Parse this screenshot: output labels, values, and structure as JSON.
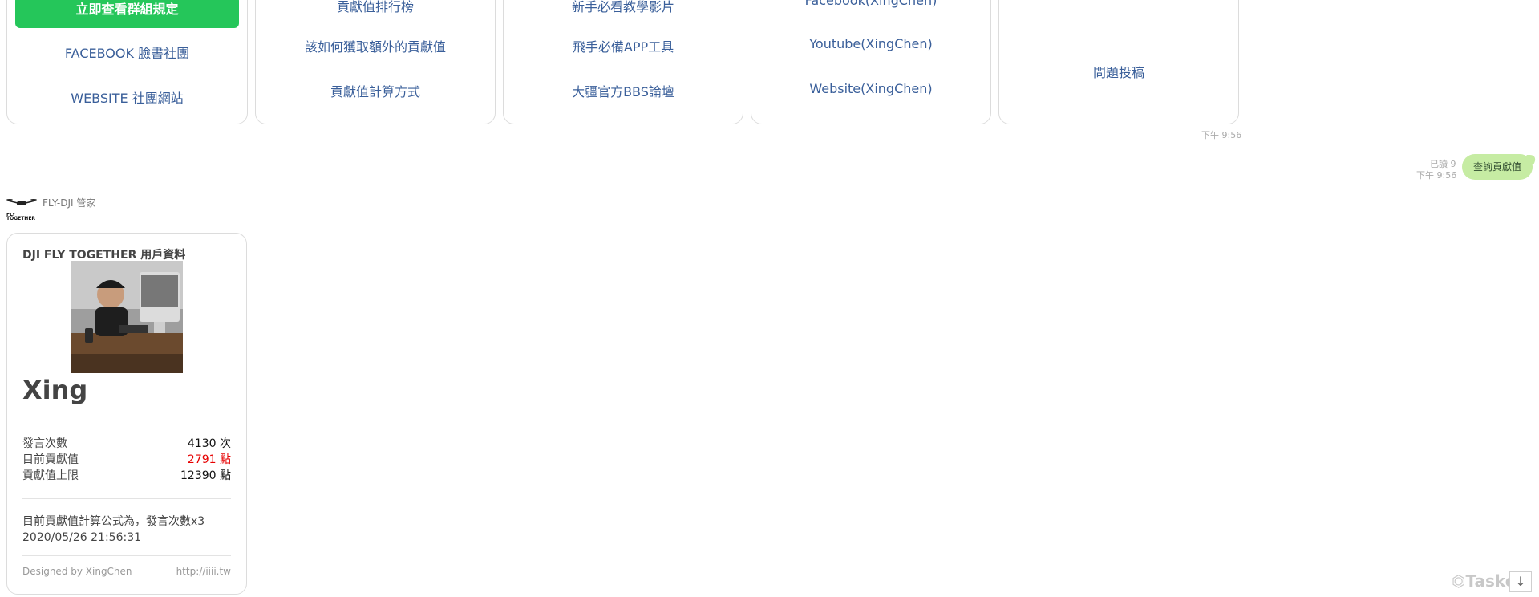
{
  "cards": [
    {
      "button_label": "立即查看群組規定",
      "links": [
        "FACEBOOK 臉書社團",
        "WEBSITE 社團網站"
      ]
    },
    {
      "links": [
        "貢獻值排行榜",
        "該如何獲取額外的貢獻值",
        "貢獻值計算方式"
      ]
    },
    {
      "links": [
        "新手必看教學影片",
        "飛手必備APP工具",
        "大疆官方BBS論壇"
      ]
    },
    {
      "links": [
        "Facebook(XingChen)",
        "Youtube(XingChen)",
        "Website(XingChen)"
      ]
    },
    {
      "links": [
        "問題投稿"
      ]
    }
  ],
  "card_timestamp": "下午 9:56",
  "sent_message": {
    "read_label": "已讀 9",
    "time": "下午 9:56",
    "text": "查詢貢獻值"
  },
  "bot": {
    "name": "FLY-DJI 管家",
    "avatar_text": "FLY TOGETHER"
  },
  "profile": {
    "title": "DJI FLY TOGETHER 用戶資料",
    "username": "Xing",
    "stats": [
      {
        "label": "發言次數",
        "value": "4130 次",
        "highlight": false
      },
      {
        "label": "目前貢獻值",
        "value": "2791 點",
        "highlight": true
      },
      {
        "label": "貢獻值上限",
        "value": "12390 點",
        "highlight": false
      }
    ],
    "formula": "目前貢獻值計算公式為，發言次數x3",
    "datetime": "2020/05/26 21:56:31",
    "designed_by": "Designed by XingChen",
    "url": "http://iiii.tw"
  },
  "watermark": "Tasker",
  "colors": {
    "button_green": "#25c65a",
    "link_blue": "#3a5f9a",
    "bubble_green": "#c6eca3",
    "highlight_red": "#e60000"
  }
}
